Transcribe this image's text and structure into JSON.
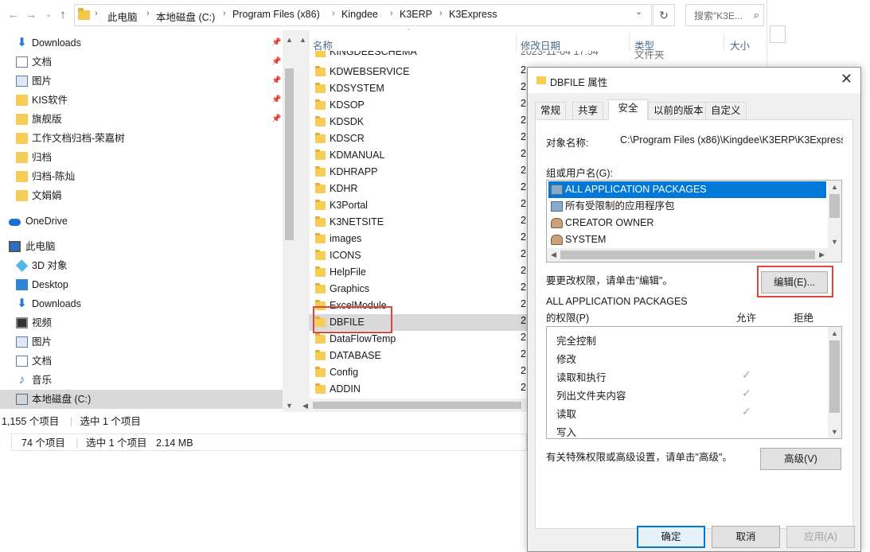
{
  "addressbar": {
    "crumbs": [
      "此电脑",
      "本地磁盘 (C:)",
      "Program Files (x86)",
      "Kingdee",
      "K3ERP",
      "K3Express"
    ],
    "search_placeholder": "搜索\"K3E..."
  },
  "nav": {
    "items": [
      {
        "label": "Downloads",
        "icon": "download-icon",
        "pinned": true
      },
      {
        "label": "文档",
        "icon": "document-icon",
        "pinned": true
      },
      {
        "label": "图片",
        "icon": "picture-icon",
        "pinned": true
      },
      {
        "label": "KIS软件",
        "icon": "folder-icon",
        "pinned": true
      },
      {
        "label": "旗舰版",
        "icon": "folder-icon",
        "pinned": true
      },
      {
        "label": "工作文档归档-荣嘉树",
        "icon": "folder-icon"
      },
      {
        "label": "归档",
        "icon": "folder-icon"
      },
      {
        "label": "归档-陈灿",
        "icon": "folder-icon"
      },
      {
        "label": "文娟娟",
        "icon": "folder-icon"
      },
      {
        "label": "OneDrive",
        "icon": "onedrive-icon"
      },
      {
        "label": "此电脑",
        "icon": "computer-icon"
      },
      {
        "label": "3D 对象",
        "icon": "3d-objects-icon"
      },
      {
        "label": "Desktop",
        "icon": "desktop-icon"
      },
      {
        "label": "Downloads",
        "icon": "download-icon"
      },
      {
        "label": "视频",
        "icon": "video-icon"
      },
      {
        "label": "图片",
        "icon": "picture-icon"
      },
      {
        "label": "文档",
        "icon": "document-icon"
      },
      {
        "label": "音乐",
        "icon": "music-icon"
      },
      {
        "label": "本地磁盘 (C:)",
        "icon": "drive-icon",
        "selected": true
      }
    ]
  },
  "filelist": {
    "columns": {
      "name": "名称",
      "date": "修改日期",
      "type": "类型",
      "size": "大小"
    },
    "partial_row": {
      "name": "KINGDEESCHEMA",
      "date": "2023-11-04 17:54",
      "type": "文件夹"
    },
    "files": [
      "KDWEBSERVICE",
      "KDSYSTEM",
      "KDSOP",
      "KDSDK",
      "KDSCR",
      "KDMANUAL",
      "KDHRAPP",
      "KDHR",
      "K3Portal",
      "K3NETSITE",
      "images",
      "ICONS",
      "HelpFile",
      "Graphics",
      "ExcelModule",
      "DBFILE",
      "DataFlowTemp",
      "DATABASE",
      "Config",
      "ADDIN"
    ],
    "selected": "DBFILE",
    "date_prefix": "2"
  },
  "status": {
    "upper": {
      "count": "1,155 个项目",
      "selected": "选中 1 个项目"
    },
    "lower": {
      "count": "74 个项目",
      "selected": "选中 1 个项目",
      "size": "2.14 MB"
    }
  },
  "dialog": {
    "title": "DBFILE 属性",
    "tabs": [
      "常规",
      "共享",
      "安全",
      "以前的版本",
      "自定义"
    ],
    "active_tab": "安全",
    "object_label": "对象名称:",
    "object_value": "C:\\Program Files (x86)\\Kingdee\\K3ERP\\K3Express",
    "group_label": "组或用户名(G):",
    "users": [
      {
        "name": "ALL APPLICATION PACKAGES",
        "selected": true
      },
      {
        "name": "所有受限制的应用程序包"
      },
      {
        "name": "CREATOR OWNER"
      },
      {
        "name": "SYSTEM"
      }
    ],
    "edit_hint": "要更改权限，请单击\"编辑\"。",
    "edit_button": "编辑(E)...",
    "perm_for": "ALL APPLICATION PACKAGES",
    "perm_title": "的权限(P)",
    "allow": "允许",
    "deny": "拒绝",
    "permissions": [
      {
        "name": "完全控制",
        "allow": false
      },
      {
        "name": "修改",
        "allow": false
      },
      {
        "name": "读取和执行",
        "allow": true
      },
      {
        "name": "列出文件夹内容",
        "allow": true
      },
      {
        "name": "读取",
        "allow": true
      },
      {
        "name": "写入",
        "allow": false
      }
    ],
    "advanced_hint": "有关特殊权限或高级设置，请单击\"高级\"。",
    "advanced_button": "高级(V)",
    "ok": "确定",
    "cancel": "取消",
    "apply": "应用(A)"
  }
}
